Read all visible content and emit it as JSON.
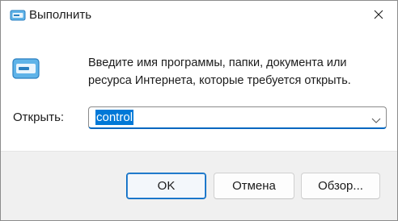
{
  "window": {
    "title": "Выполнить",
    "title_icon": "run-dialog-icon",
    "close_icon": "close-icon"
  },
  "content": {
    "icon": "run-dialog-icon",
    "description": "Введите имя программы, папки, документа или ресурса Интернета, которые требуется открыть.",
    "open_label": "Открыть:",
    "open_value": "control",
    "dropdown_icon": "chevron-down-icon"
  },
  "buttons": {
    "ok": "OK",
    "cancel": "Отмена",
    "browse": "Обзор..."
  },
  "colors": {
    "accent": "#0067c0",
    "selection": "#0078d7",
    "footer_bg": "#f0f0f0"
  }
}
